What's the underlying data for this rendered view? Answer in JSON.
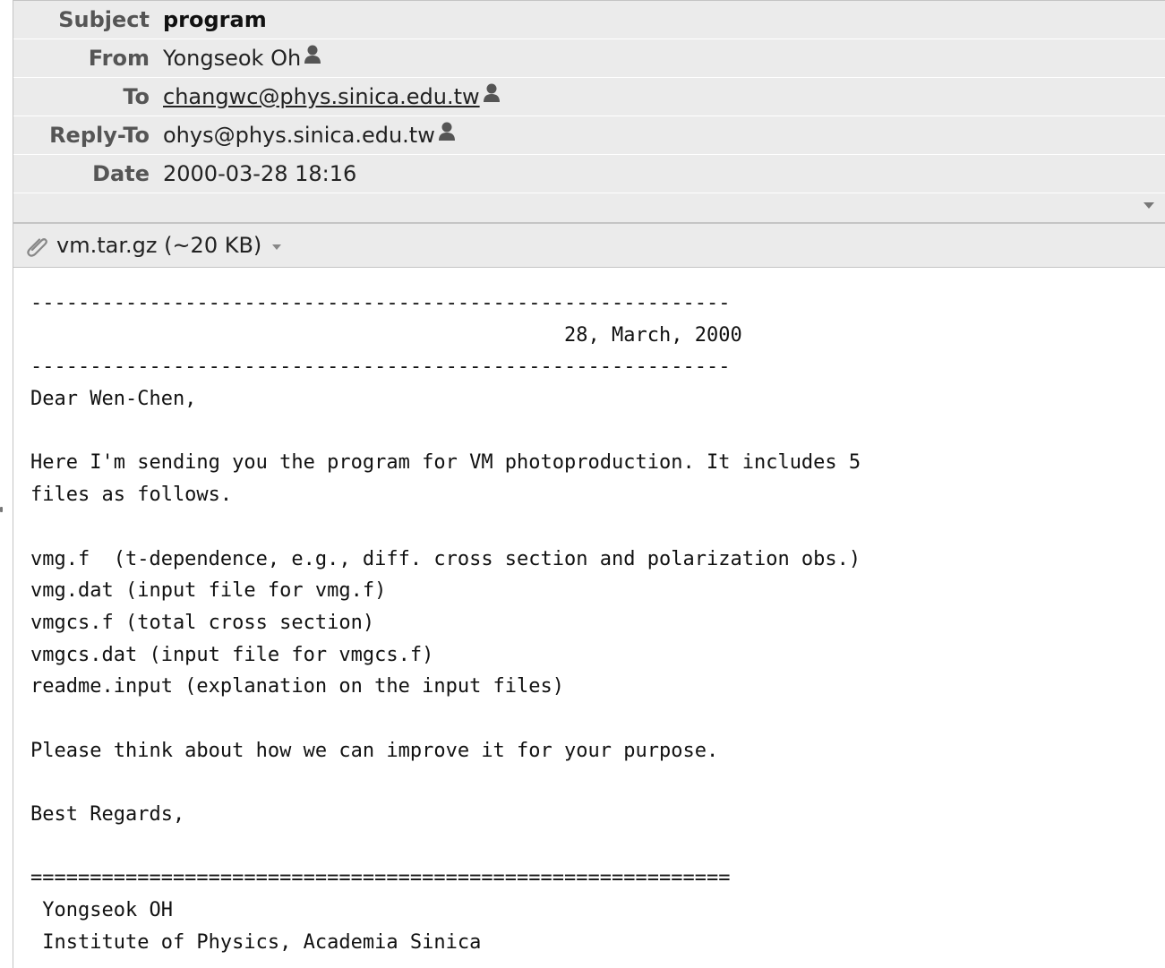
{
  "headers": {
    "subject_label": "Subject",
    "subject": "program",
    "from_label": "From",
    "from": "Yongseok Oh",
    "to_label": "To",
    "to": "changwc@phys.sinica.edu.tw",
    "reply_to_label": "Reply-To",
    "reply_to": "ohys@phys.sinica.edu.tw",
    "date_label": "Date",
    "date": "2000-03-28 18:16"
  },
  "attachment": {
    "icon": "paperclip-icon",
    "label": "vm.tar.gz (~20 KB)"
  },
  "body_lines": [
    "-----------------------------------------------------------",
    "                                             28, March, 2000",
    "-----------------------------------------------------------",
    "Dear Wen-Chen,",
    "",
    "Here I'm sending you the program for VM photoproduction. It includes 5",
    "files as follows.",
    "",
    "vmg.f  (t-dependence, e.g., diff. cross section and polarization obs.)",
    "vmg.dat (input file for vmg.f)",
    "vmgcs.f (total cross section)",
    "vmgcs.dat (input file for vmgcs.f)",
    "readme.input (explanation on the input files)",
    "",
    "Please think about how we can improve it for your purpose.",
    "",
    "Best Regards,",
    "",
    "===========================================================",
    " Yongseok OH",
    " Institute of Physics, Academia Sinica"
  ]
}
